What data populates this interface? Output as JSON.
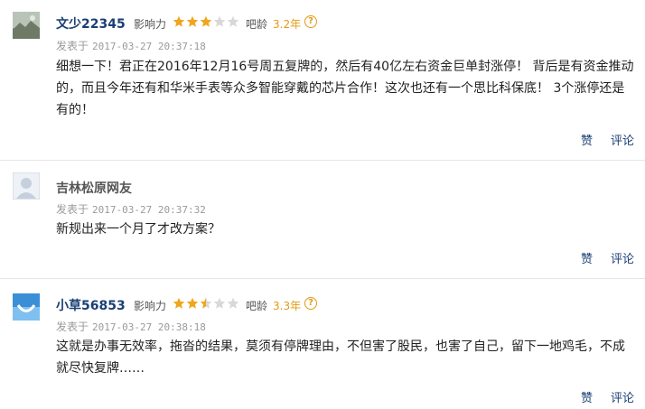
{
  "comments": [
    {
      "username": "文少22345",
      "influence_label": "影响力",
      "influence_stars": 3,
      "age_label": "吧龄",
      "age_value": "3.2年",
      "help_glyph": "?",
      "posted_label": "发表于",
      "posted_time": "2017-03-27 20:37:18",
      "content": "细想一下！君正在2016年12月16号周五复牌的，然后有40亿左右资金巨单封涨停！  背后是有资金推动的，而且今年还有和华米手表等众多智能穿戴的芯片合作！这次也还有一个思比科保底！  3个涨停还是有的！",
      "like_label": "赞",
      "reply_label": "评论",
      "avatar_icon": "landscape-avatar-icon"
    },
    {
      "username": "吉林松原网友",
      "posted_label": "发表于",
      "posted_time": "2017-03-27 20:37:32",
      "content": "新规出来一个月了才改方案？",
      "like_label": "赞",
      "reply_label": "评论",
      "avatar_icon": "default-user-avatar-icon"
    },
    {
      "username": "小草56853",
      "influence_label": "影响力",
      "influence_stars": 2.5,
      "age_label": "吧龄",
      "age_value": "3.3年",
      "help_glyph": "?",
      "posted_label": "发表于",
      "posted_time": "2017-03-27 20:38:18",
      "content": "这就是办事无效率，拖沓的结果，莫须有停牌理由，不但害了股民，也害了自己，留下一地鸡毛，不成就尽快复牌……",
      "like_label": "赞",
      "reply_label": "评论",
      "avatar_icon": "blue-smile-avatar-icon"
    }
  ],
  "colors": {
    "username": "#1a3f74",
    "star_filled": "#f0a61c",
    "star_empty": "#d8d8d8",
    "age": "#e39a14"
  }
}
